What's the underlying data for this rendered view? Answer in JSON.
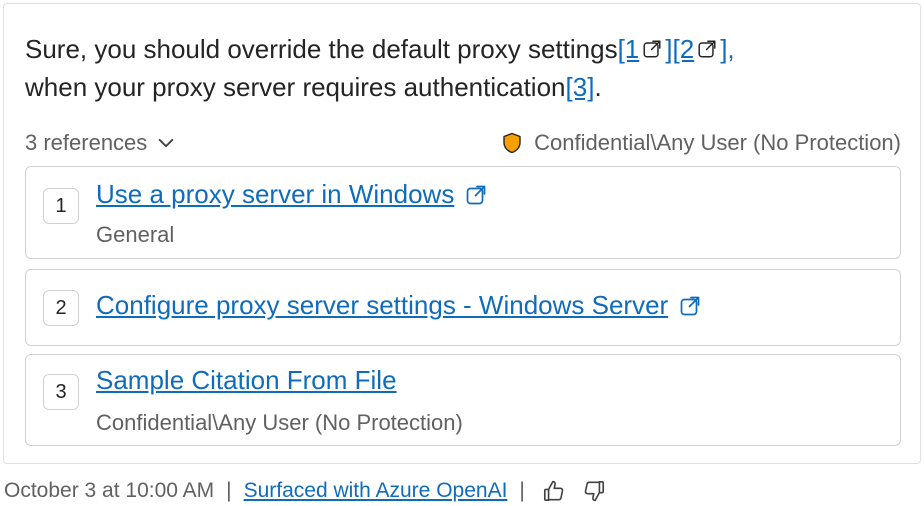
{
  "message": {
    "text_before": "Sure, you should override the default proxy settings",
    "citation_1": "[1",
    "citation_2": "[2",
    "close_1": "]",
    "close_2": "],",
    "text_middle": "when your proxy server requires authentication",
    "citation_3": "[3]",
    "text_end": "."
  },
  "references": {
    "toggle_label": "3 references",
    "sensitivity_label": "Confidential\\Any User (No Protection)",
    "items": [
      {
        "number": "1",
        "title": "Use a proxy server in Windows",
        "subtitle": "General"
      },
      {
        "number": "2",
        "title": "Configure proxy server settings - Windows Server",
        "subtitle": ""
      },
      {
        "number": "3",
        "title": "Sample Citation From File",
        "subtitle": "Confidential\\Any User (No Protection)"
      }
    ]
  },
  "footer": {
    "timestamp": "October 3 at 10:00 AM",
    "separator": "|",
    "link": "Surfaced with Azure OpenAI"
  },
  "colors": {
    "link": "#0f6cbd",
    "shield": "#f7a000",
    "muted_text": "#616161"
  },
  "icons": {
    "external_link": "open-in-new-icon",
    "chevron": "chevron-down-icon",
    "shield": "shield-icon",
    "like": "thumbs-up-icon",
    "dislike": "thumbs-down-icon"
  }
}
